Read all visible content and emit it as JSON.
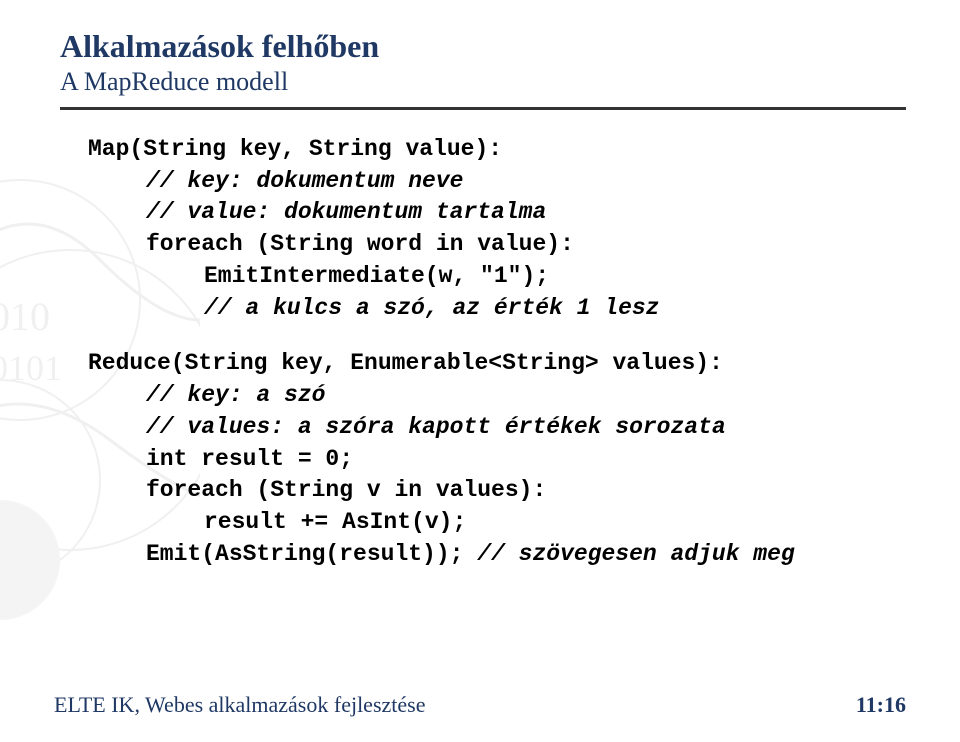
{
  "header": {
    "title": "Alkalmazások felhőben",
    "subtitle": "A MapReduce modell"
  },
  "code": {
    "map_sig": "Map(String key, String value):",
    "map_c1": "// key: dokumentum neve",
    "map_c2": "// value: dokumentum tartalma",
    "map_foreach": "foreach (String word in value):",
    "map_emit": "EmitIntermediate(w, \"1\");",
    "map_c3": "// a kulcs a szó, az érték 1 lesz",
    "reduce_sig": "Reduce(String key, Enumerable<String> values):",
    "reduce_c1": "// key: a szó",
    "reduce_c2": "// values: a szóra kapott értékek sorozata",
    "reduce_init": "int result = 0;",
    "reduce_foreach": "foreach (String v in values):",
    "reduce_acc": "result += AsInt(v);",
    "reduce_emit_pre": "Emit(AsString(result)); ",
    "reduce_emit_comment": "// szövegesen adjuk meg"
  },
  "footer": {
    "left": "ELTE IK, Webes alkalmazások fejlesztése",
    "right": "11:16"
  }
}
